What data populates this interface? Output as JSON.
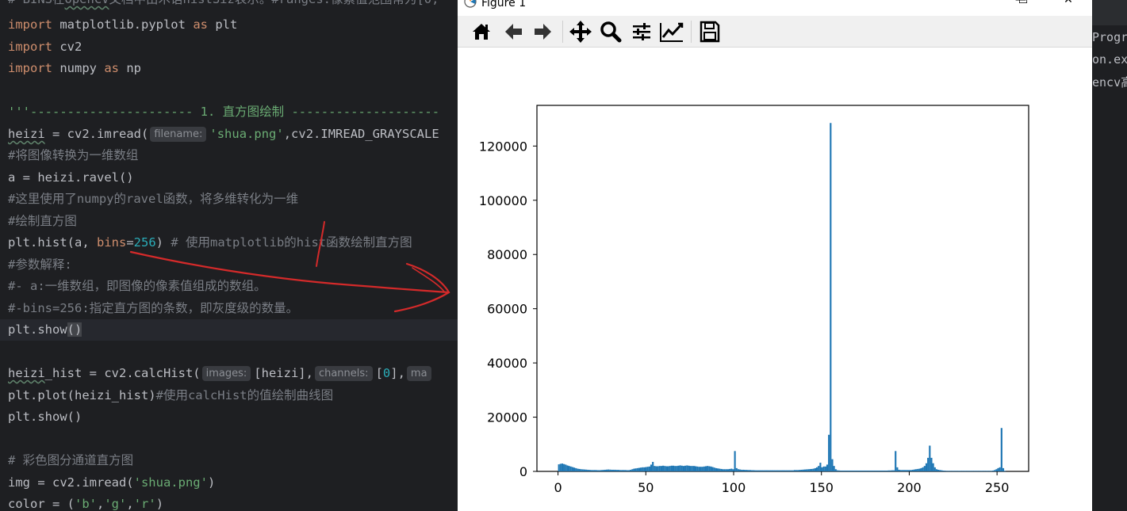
{
  "editor": {
    "lines": {
      "l0_a": "# BINS在",
      "l0_b": "OpenCV",
      "l0_c": "文档中由术语histSiz表示。#ranges:像素值范围常为[0,",
      "l1_kw": "import",
      "l1_rest": " matplotlib.pyplot ",
      "l1_as": "as",
      "l1_alias": " plt",
      "l2_kw": "import",
      "l2_rest": " cv2",
      "l3_kw": "import",
      "l3_rest": " numpy ",
      "l3_as": "as",
      "l3_alias": " np",
      "l5": "'''---------------------- 1. 直方图绘制 --------------------",
      "l6_var": "heizi",
      "l6_a": " = cv2.imread(",
      "l6_hint": "filename:",
      "l6_str": "'shua.png'",
      "l6_b": ",cv2.IMREAD_GRAYSCALE",
      "l7": "#将图像转换为一维数组",
      "l8": "a = heizi.ravel()",
      "l9": "#这里使用了numpy的ravel函数，将多维转化为一维",
      "l10": "#绘制直方图",
      "l11_a": "plt.hist(a, ",
      "l11_param": "bins",
      "l11_eq": "=",
      "l11_num": "256",
      "l11_b": ") ",
      "l11_cm": "# 使用matplotlib的hist函数绘制直方图",
      "l12": "#参数解释:",
      "l13": "#- a:一维数组，即图像的像素值组成的数组。",
      "l14": "#-bins=256:指定直方图的条数，即灰度级的数量。",
      "l15_a": "plt.show",
      "l15_b": "()",
      "l17_var": "heizi",
      "l17_a": "_hist = cv2.calcHist(",
      "l17_hint1": "images:",
      "l17_b": "[heizi],",
      "l17_hint2": "channels:",
      "l17_c": "[",
      "l17_num": "0",
      "l17_d": "],",
      "l17_hint3": "ma",
      "l18_a": "plt.plot(heizi_hist)",
      "l18_cm": "#使用calcHist的值绘制曲线图",
      "l19": "plt.show()",
      "l21": "# 彩色图分通道直方图",
      "l22_a": "img = cv2.imread(",
      "l22_str": "'shua.png'",
      "l22_b": ")",
      "l23_a": "color = (",
      "l23_s1": "'b'",
      "l23_c1": ",",
      "l23_s2": "'g'",
      "l23_c2": ",",
      "l23_s3": "'r'",
      "l23_b": ")"
    }
  },
  "right_panel": {
    "lines": [
      "Progr",
      "on.ex",
      "encv高"
    ]
  },
  "figure": {
    "title": "Figure 1",
    "minimize_glyph": "—",
    "maximize_glyph": "☐",
    "close_glyph": "✕",
    "toolbar": {
      "icons": [
        "home-icon",
        "back-icon",
        "forward-icon",
        "pan-icon",
        "zoom-icon",
        "configure-subplots-icon",
        "edit-axis-icon",
        "save-icon"
      ]
    }
  },
  "colors": {
    "bar": "#1f77b4",
    "annotation": "#d42a2a"
  },
  "chart_data": {
    "type": "bar",
    "title": "",
    "xlabel": "",
    "ylabel": "",
    "xlim": [
      -12,
      268
    ],
    "ylim": [
      0,
      135000
    ],
    "xticks": [
      0,
      50,
      100,
      150,
      200,
      250
    ],
    "yticks": [
      0,
      20000,
      40000,
      60000,
      80000,
      100000,
      120000
    ],
    "grid": false,
    "bins": 256,
    "values": [
      2600,
      2800,
      2900,
      2700,
      2500,
      2200,
      2000,
      1800,
      1600,
      1400,
      1200,
      1000,
      900,
      800,
      750,
      700,
      650,
      600,
      550,
      500,
      500,
      500,
      480,
      450,
      450,
      500,
      550,
      600,
      650,
      700,
      650,
      600,
      600,
      600,
      550,
      550,
      500,
      500,
      500,
      500,
      450,
      450,
      600,
      800,
      1000,
      1100,
      1200,
      1300,
      1400,
      1500,
      1500,
      1600,
      1700,
      1800,
      2500,
      3500,
      2000,
      1900,
      1900,
      2000,
      2000,
      2100,
      2000,
      1900,
      1900,
      2000,
      2100,
      2100,
      2000,
      2000,
      2100,
      2200,
      2100,
      2000,
      2100,
      2200,
      2100,
      2000,
      2000,
      2000,
      1900,
      1800,
      1700,
      1700,
      1700,
      1800,
      1900,
      2000,
      1900,
      1800,
      1600,
      1400,
      1200,
      1100,
      1000,
      900,
      800,
      800,
      800,
      800,
      900,
      1000,
      800,
      7500,
      1200,
      800,
      700,
      600,
      600,
      550,
      550,
      500,
      500,
      450,
      450,
      400,
      400,
      400,
      400,
      400,
      400,
      400,
      400,
      400,
      400,
      400,
      400,
      400,
      400,
      400,
      400,
      400,
      400,
      400,
      400,
      400,
      400,
      400,
      500,
      500,
      500,
      550,
      600,
      650,
      700,
      750,
      800,
      850,
      900,
      1000,
      1200,
      1500,
      2000,
      3200,
      1500,
      1800,
      1800,
      2500,
      13500,
      128500,
      4500,
      2000,
      800,
      400,
      350,
      300,
      300,
      300,
      300,
      300,
      300,
      300,
      300,
      300,
      300,
      300,
      300,
      300,
      300,
      300,
      300,
      300,
      300,
      300,
      300,
      300,
      300,
      300,
      300,
      300,
      300,
      300,
      300,
      350,
      350,
      400,
      400,
      7500,
      1500,
      600,
      500,
      500,
      500,
      500,
      500,
      500,
      500,
      600,
      700,
      800,
      900,
      1000,
      1200,
      1500,
      2000,
      3000,
      5000,
      9500,
      5000,
      3000,
      1500,
      800,
      600,
      500,
      400,
      300,
      250,
      200,
      200,
      200,
      200,
      200,
      200,
      200,
      200,
      200,
      200,
      200,
      200,
      200,
      200,
      200,
      200,
      200,
      200,
      200,
      200,
      200,
      200,
      200,
      200,
      200,
      200,
      200,
      300,
      500,
      800,
      1200,
      1500,
      16000,
      1200,
      200
    ],
    "value_offset": 0
  }
}
